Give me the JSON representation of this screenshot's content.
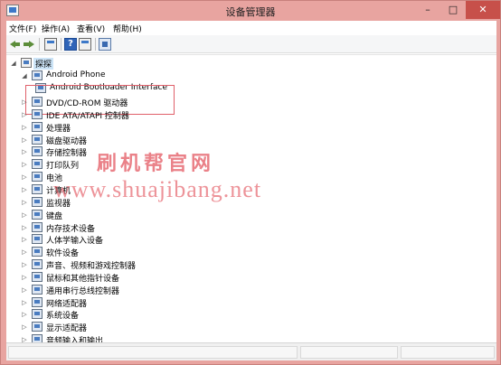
{
  "window": {
    "title": "设备管理器",
    "controls": {
      "minimize": "–",
      "maximize": "□",
      "close": "✕"
    }
  },
  "menu": [
    "文件(F)",
    "操作(A)",
    "查看(V)",
    "帮助(H)"
  ],
  "toolbar": {
    "icons": [
      "back-arrow-icon",
      "forward-arrow-icon",
      "properties-icon",
      "help-icon",
      "view-icon",
      "scan-hardware-icon"
    ],
    "help_glyph": "?"
  },
  "tree": {
    "root": "探探",
    "expanded_device_group": "Android Phone",
    "expanded_child": "Android Bootloader Interface",
    "categories": [
      "DVD/CD-ROM 驱动器",
      "IDE ATA/ATAPI 控制器",
      "处理器",
      "磁盘驱动器",
      "存储控制器",
      "打印队列",
      "电池",
      "计算机",
      "监视器",
      "键盘",
      "内存技术设备",
      "人体学输入设备",
      "软件设备",
      "声音、视频和游戏控制器",
      "鼠标和其他指针设备",
      "通用串行总线控制器",
      "网络适配器",
      "系统设备",
      "显示适配器",
      "音频输入和输出"
    ],
    "expand_glyph": "▷",
    "collapse_glyph": "◢"
  },
  "watermark": {
    "title": "刷机帮官网",
    "url": "www.shuajibang.net"
  },
  "colors": {
    "titlebar": "#e8a4a0",
    "close_button": "#c7504a",
    "highlight_border": "#e0606a",
    "watermark": "#e2505a",
    "selection": "#cce4f7"
  }
}
